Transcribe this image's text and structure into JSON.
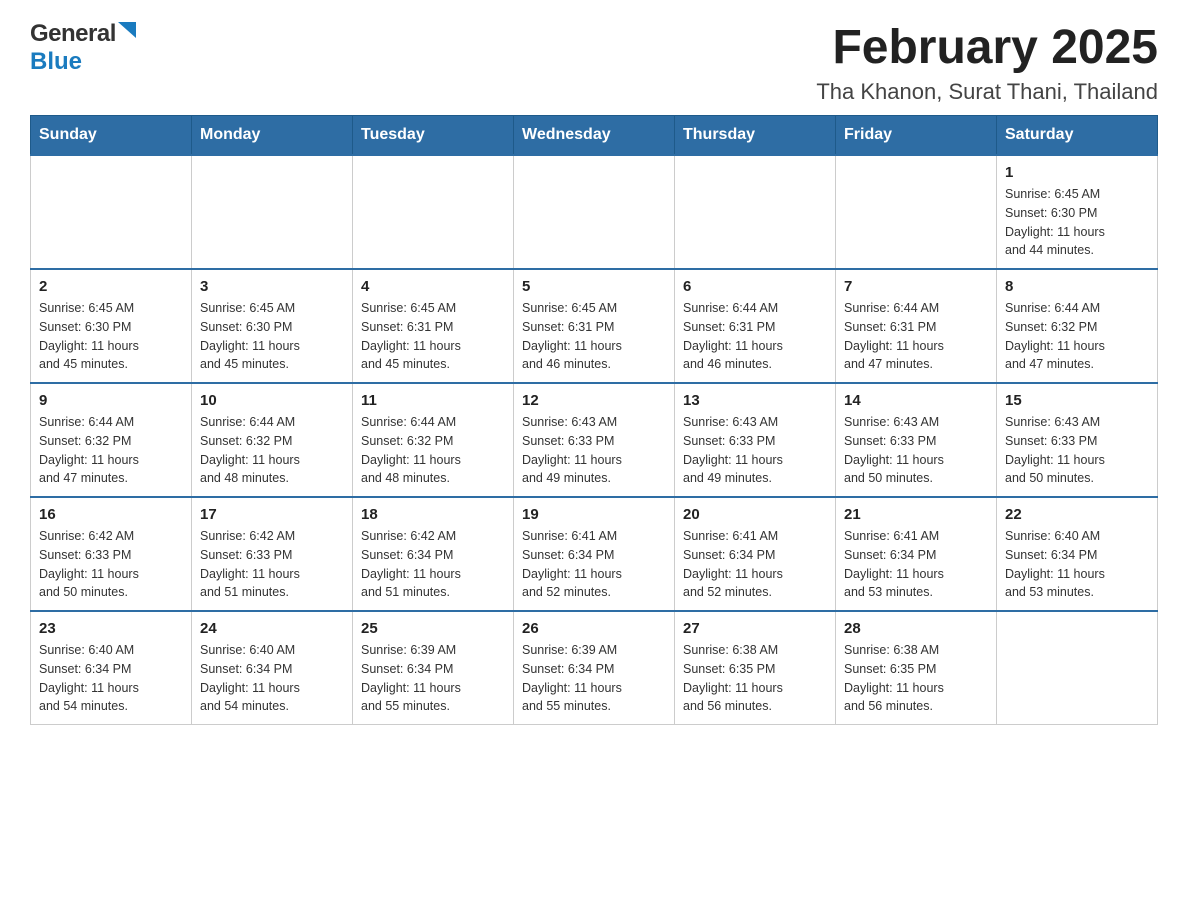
{
  "header": {
    "logo": {
      "general": "General",
      "blue": "Blue"
    },
    "title": "February 2025",
    "location": "Tha Khanon, Surat Thani, Thailand"
  },
  "days_of_week": [
    "Sunday",
    "Monday",
    "Tuesday",
    "Wednesday",
    "Thursday",
    "Friday",
    "Saturday"
  ],
  "weeks": [
    [
      {
        "day": "",
        "info": ""
      },
      {
        "day": "",
        "info": ""
      },
      {
        "day": "",
        "info": ""
      },
      {
        "day": "",
        "info": ""
      },
      {
        "day": "",
        "info": ""
      },
      {
        "day": "",
        "info": ""
      },
      {
        "day": "1",
        "info": "Sunrise: 6:45 AM\nSunset: 6:30 PM\nDaylight: 11 hours\nand 44 minutes."
      }
    ],
    [
      {
        "day": "2",
        "info": "Sunrise: 6:45 AM\nSunset: 6:30 PM\nDaylight: 11 hours\nand 45 minutes."
      },
      {
        "day": "3",
        "info": "Sunrise: 6:45 AM\nSunset: 6:30 PM\nDaylight: 11 hours\nand 45 minutes."
      },
      {
        "day": "4",
        "info": "Sunrise: 6:45 AM\nSunset: 6:31 PM\nDaylight: 11 hours\nand 45 minutes."
      },
      {
        "day": "5",
        "info": "Sunrise: 6:45 AM\nSunset: 6:31 PM\nDaylight: 11 hours\nand 46 minutes."
      },
      {
        "day": "6",
        "info": "Sunrise: 6:44 AM\nSunset: 6:31 PM\nDaylight: 11 hours\nand 46 minutes."
      },
      {
        "day": "7",
        "info": "Sunrise: 6:44 AM\nSunset: 6:31 PM\nDaylight: 11 hours\nand 47 minutes."
      },
      {
        "day": "8",
        "info": "Sunrise: 6:44 AM\nSunset: 6:32 PM\nDaylight: 11 hours\nand 47 minutes."
      }
    ],
    [
      {
        "day": "9",
        "info": "Sunrise: 6:44 AM\nSunset: 6:32 PM\nDaylight: 11 hours\nand 47 minutes."
      },
      {
        "day": "10",
        "info": "Sunrise: 6:44 AM\nSunset: 6:32 PM\nDaylight: 11 hours\nand 48 minutes."
      },
      {
        "day": "11",
        "info": "Sunrise: 6:44 AM\nSunset: 6:32 PM\nDaylight: 11 hours\nand 48 minutes."
      },
      {
        "day": "12",
        "info": "Sunrise: 6:43 AM\nSunset: 6:33 PM\nDaylight: 11 hours\nand 49 minutes."
      },
      {
        "day": "13",
        "info": "Sunrise: 6:43 AM\nSunset: 6:33 PM\nDaylight: 11 hours\nand 49 minutes."
      },
      {
        "day": "14",
        "info": "Sunrise: 6:43 AM\nSunset: 6:33 PM\nDaylight: 11 hours\nand 50 minutes."
      },
      {
        "day": "15",
        "info": "Sunrise: 6:43 AM\nSunset: 6:33 PM\nDaylight: 11 hours\nand 50 minutes."
      }
    ],
    [
      {
        "day": "16",
        "info": "Sunrise: 6:42 AM\nSunset: 6:33 PM\nDaylight: 11 hours\nand 50 minutes."
      },
      {
        "day": "17",
        "info": "Sunrise: 6:42 AM\nSunset: 6:33 PM\nDaylight: 11 hours\nand 51 minutes."
      },
      {
        "day": "18",
        "info": "Sunrise: 6:42 AM\nSunset: 6:34 PM\nDaylight: 11 hours\nand 51 minutes."
      },
      {
        "day": "19",
        "info": "Sunrise: 6:41 AM\nSunset: 6:34 PM\nDaylight: 11 hours\nand 52 minutes."
      },
      {
        "day": "20",
        "info": "Sunrise: 6:41 AM\nSunset: 6:34 PM\nDaylight: 11 hours\nand 52 minutes."
      },
      {
        "day": "21",
        "info": "Sunrise: 6:41 AM\nSunset: 6:34 PM\nDaylight: 11 hours\nand 53 minutes."
      },
      {
        "day": "22",
        "info": "Sunrise: 6:40 AM\nSunset: 6:34 PM\nDaylight: 11 hours\nand 53 minutes."
      }
    ],
    [
      {
        "day": "23",
        "info": "Sunrise: 6:40 AM\nSunset: 6:34 PM\nDaylight: 11 hours\nand 54 minutes."
      },
      {
        "day": "24",
        "info": "Sunrise: 6:40 AM\nSunset: 6:34 PM\nDaylight: 11 hours\nand 54 minutes."
      },
      {
        "day": "25",
        "info": "Sunrise: 6:39 AM\nSunset: 6:34 PM\nDaylight: 11 hours\nand 55 minutes."
      },
      {
        "day": "26",
        "info": "Sunrise: 6:39 AM\nSunset: 6:34 PM\nDaylight: 11 hours\nand 55 minutes."
      },
      {
        "day": "27",
        "info": "Sunrise: 6:38 AM\nSunset: 6:35 PM\nDaylight: 11 hours\nand 56 minutes."
      },
      {
        "day": "28",
        "info": "Sunrise: 6:38 AM\nSunset: 6:35 PM\nDaylight: 11 hours\nand 56 minutes."
      },
      {
        "day": "",
        "info": ""
      }
    ]
  ]
}
